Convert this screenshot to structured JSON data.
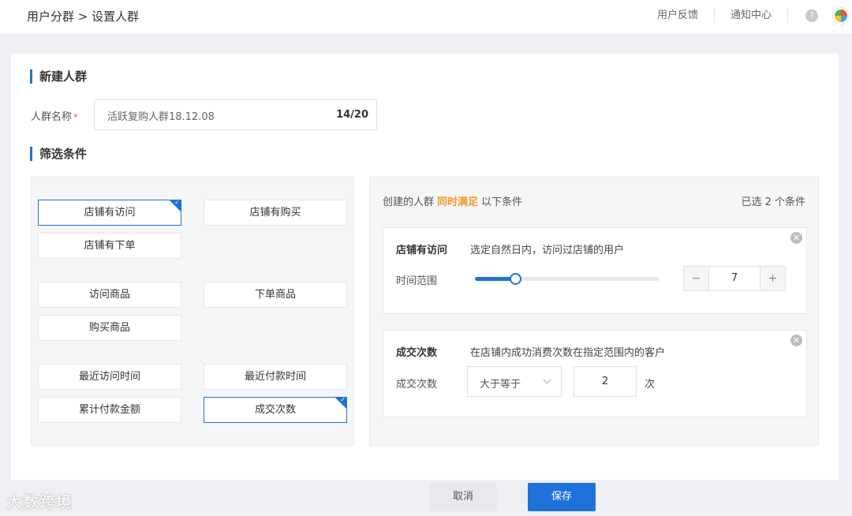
{
  "topbar": {
    "breadcrumb": "用户分群 > 设置人群",
    "feedback": "用户反馈",
    "notifications": "通知中心",
    "help": "?"
  },
  "create": {
    "title": "新建人群",
    "name_label": "人群名称",
    "required_mark": "*",
    "name_value": "活跃复购人群18.12.08",
    "char_count": "14/20"
  },
  "filter": {
    "title": "筛选条件",
    "options": [
      {
        "label": "店铺有访问",
        "selected": true
      },
      {
        "label": "店铺有购买",
        "selected": false
      },
      {
        "label": "店铺有下单",
        "selected": false
      },
      {
        "label": "访问商品",
        "selected": false
      },
      {
        "label": "下单商品",
        "selected": false
      },
      {
        "label": "购买商品",
        "selected": false
      },
      {
        "label": "最近访问时间",
        "selected": false
      },
      {
        "label": "最近付款时间",
        "selected": false
      },
      {
        "label": "累计付款金额",
        "selected": false
      },
      {
        "label": "成交次数",
        "selected": true
      }
    ]
  },
  "result": {
    "head_prefix": "创建的人群",
    "head_highlight": "同时满足",
    "head_suffix": "以下条件",
    "selected_count": "已选 2 个条件",
    "highlight_color": "#f39a2b",
    "card_visit": {
      "title": "店铺有访问",
      "description": "选定自然日内，访问过店铺的用户",
      "field_label": "时间范围",
      "slider_fraction": 0.22,
      "minus": "−",
      "value": "7",
      "plus": "+"
    },
    "card_orders": {
      "title": "成交次数",
      "description": "在店铺内成功消费次数在指定范围内的客户",
      "field_label": "成交次数",
      "operator": "大于等于",
      "value": "2",
      "unit": "次"
    }
  },
  "actions": {
    "cancel": "取消",
    "save": "保存"
  },
  "watermark": "大数跨境",
  "colors": {
    "accent": "#1e72d7",
    "danger": "#e84a3c"
  }
}
